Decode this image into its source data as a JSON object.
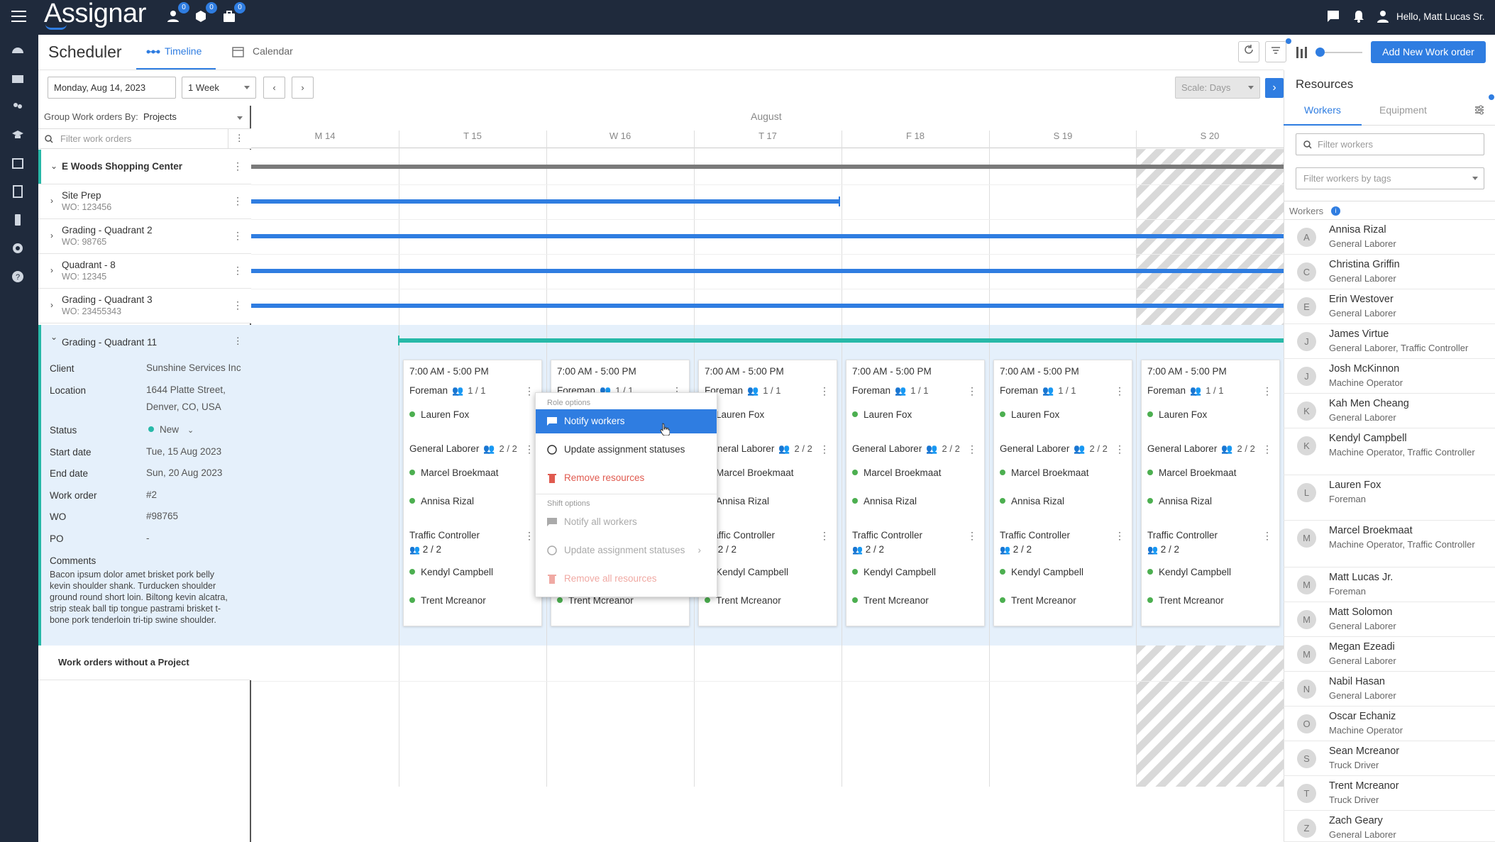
{
  "header": {
    "logo": "Assignar",
    "greeting": "Hello, Matt Lucas Sr.",
    "badges": [
      "0",
      "0",
      "0"
    ]
  },
  "toolbar": {
    "title": "Scheduler",
    "tabs": [
      "Timeline",
      "Calendar"
    ],
    "add_button": "Add New Work order",
    "date": "Monday, Aug 14, 2023",
    "range": "1 Week",
    "scale_label": "Scale:",
    "scale_value": "Days"
  },
  "left": {
    "group_by_label": "Group Work orders By:",
    "group_by_value": "Projects",
    "filter_placeholder": "Filter work orders",
    "no_project": "Work orders without a Project"
  },
  "projects": [
    {
      "name": "E Woods Shopping Center",
      "wo": ""
    },
    {
      "name": "Site Prep",
      "wo": "WO: 123456"
    },
    {
      "name": "Grading - Quadrant 2",
      "wo": "WO: 98765"
    },
    {
      "name": "Quadrant - 8",
      "wo": "WO: 12345"
    },
    {
      "name": "Grading - Quadrant 3",
      "wo": "WO: 23455343"
    },
    {
      "name": "Grading - Quadrant 11",
      "wo": ""
    }
  ],
  "details": {
    "labels": [
      "Client",
      "Location",
      "Status",
      "Start date",
      "End date",
      "Work order",
      "WO",
      "PO",
      "Comments"
    ],
    "client": "Sunshine Services Inc",
    "location": "1644 Platte Street, Denver, CO, USA",
    "status": "New",
    "start": "Tue, 15 Aug 2023",
    "end": "Sun, 20 Aug 2023",
    "work_order": "#2",
    "wo": "#98765",
    "po": "-",
    "comments": "Bacon ipsum dolor amet brisket pork belly kevin shoulder shank. Turducken shoulder ground round short loin. Biltong kevin alcatra, strip steak ball tip tongue pastrami brisket t-bone pork tenderloin tri-tip swine shoulder."
  },
  "timeline": {
    "month": "August",
    "days": [
      "M 14",
      "T 15",
      "W 16",
      "T 17",
      "F 18",
      "S 19",
      "S 20"
    ]
  },
  "shift": {
    "time": "7:00 AM - 5:00 PM",
    "roles": [
      {
        "name": "Foreman",
        "count": "1 / 1",
        "workers": [
          "Lauren Fox"
        ]
      },
      {
        "name": "General Laborer",
        "count": "2 / 2",
        "workers": [
          "Marcel Broekmaat",
          "Annisa Rizal"
        ]
      },
      {
        "name": "Traffic Controller",
        "count": "2 / 2",
        "workers": [
          "Kendyl Campbell",
          "Trent Mcreanor"
        ]
      }
    ]
  },
  "menu": {
    "role_section": "Role options",
    "notify": "Notify workers",
    "update": "Update assignment statuses",
    "remove": "Remove resources",
    "shift_section": "Shift options",
    "notify_all": "Notify all workers",
    "update_all": "Update assignment statuses",
    "remove_all": "Remove all resources"
  },
  "resources": {
    "title": "Resources",
    "tabs": [
      "Workers",
      "Equipment"
    ],
    "filter_placeholder": "Filter workers",
    "tags_placeholder": "Filter workers by tags",
    "workers_label": "Workers"
  },
  "workers": [
    {
      "initial": "A",
      "name": "Annisa Rizal",
      "role": "General Laborer"
    },
    {
      "initial": "C",
      "name": "Christina Griffin",
      "role": "General Laborer"
    },
    {
      "initial": "E",
      "name": "Erin Westover",
      "role": "General Laborer"
    },
    {
      "initial": "J",
      "name": "James Virtue",
      "role": "General Laborer, Traffic Controller"
    },
    {
      "initial": "J",
      "name": "Josh McKinnon",
      "role": "Machine Operator"
    },
    {
      "initial": "K",
      "name": "Kah Men Cheang",
      "role": "General Laborer"
    },
    {
      "initial": "K",
      "name": "Kendyl Campbell",
      "role": "Machine Operator, Traffic Controller"
    },
    {
      "initial": "L",
      "name": "Lauren Fox",
      "role": "Foreman"
    },
    {
      "initial": "M",
      "name": "Marcel Broekmaat",
      "role": "Machine Operator, Traffic Controller"
    },
    {
      "initial": "M",
      "name": "Matt Lucas Jr.",
      "role": "Foreman"
    },
    {
      "initial": "M",
      "name": "Matt Solomon",
      "role": "General Laborer"
    },
    {
      "initial": "M",
      "name": "Megan Ezeadi",
      "role": "General Laborer"
    },
    {
      "initial": "N",
      "name": "Nabil Hasan",
      "role": "General Laborer"
    },
    {
      "initial": "O",
      "name": "Oscar Echaniz",
      "role": "Machine Operator"
    },
    {
      "initial": "S",
      "name": "Sean Mcreanor",
      "role": "Truck Driver"
    },
    {
      "initial": "T",
      "name": "Trent Mcreanor",
      "role": "Truck Driver"
    },
    {
      "initial": "Z",
      "name": "Zach Geary",
      "role": "General Laborer"
    }
  ],
  "colors": {
    "accent": "#2f7de1",
    "topbar": "#1f2a3c",
    "teal": "#27b9a8",
    "status_new": "#27b9a8",
    "worker_dot": "#4caf50"
  }
}
